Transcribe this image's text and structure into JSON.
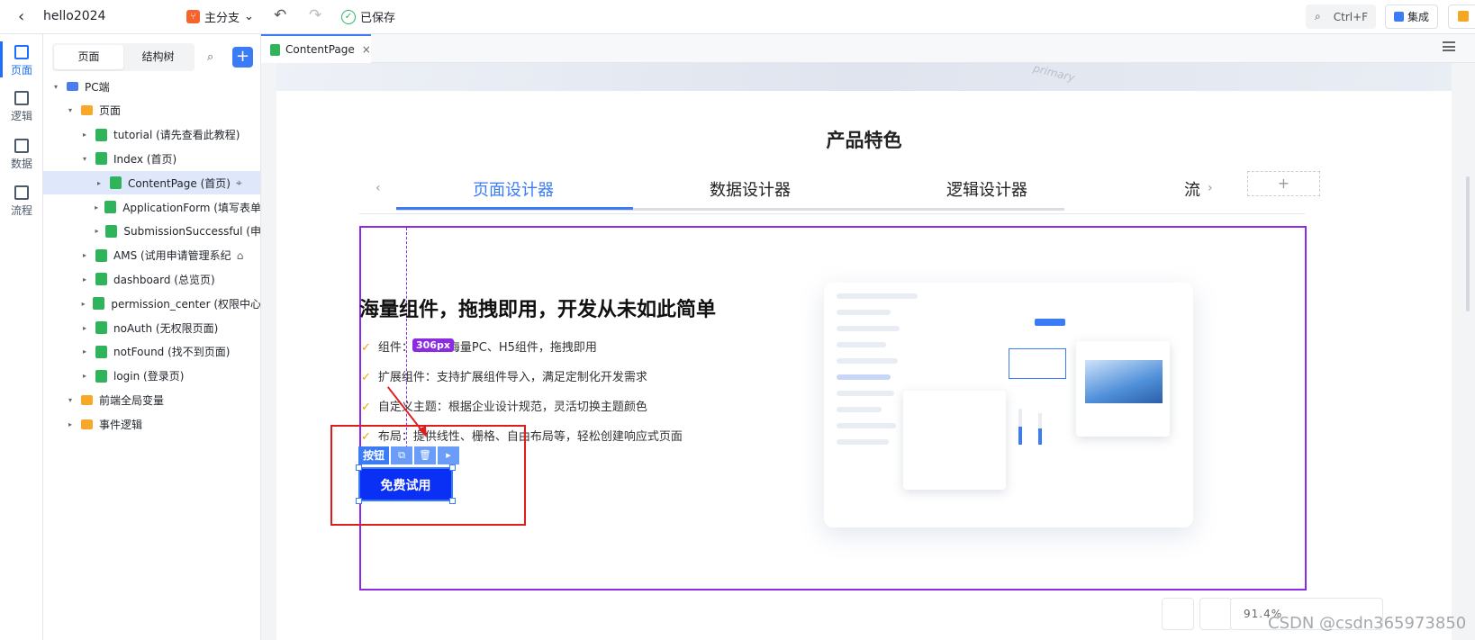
{
  "topbar": {
    "project": "hello2024",
    "branch": "主分支",
    "saved": "已保存",
    "search_shortcut": "Ctrl+F",
    "integrate": "集成"
  },
  "rail": [
    {
      "label": "页面",
      "icon": "page-icon"
    },
    {
      "label": "逻辑",
      "icon": "logic-icon"
    },
    {
      "label": "数据",
      "icon": "data-icon"
    },
    {
      "label": "流程",
      "icon": "flow-icon"
    }
  ],
  "tree": {
    "tabs": [
      "页面",
      "结构树"
    ],
    "nodes": [
      {
        "label": "PC端",
        "type": "pc",
        "depth": 0,
        "caret": "▾"
      },
      {
        "label": "页面",
        "type": "folder",
        "depth": 1,
        "caret": "▾"
      },
      {
        "label": "tutorial (请先查看此教程)",
        "type": "page",
        "depth": 2,
        "caret": "▸"
      },
      {
        "label": "Index (首页)",
        "type": "page",
        "depth": 2,
        "caret": "▾"
      },
      {
        "label": "ContentPage (首页)",
        "type": "page",
        "depth": 3,
        "caret": "▸",
        "selected": true,
        "suffix": "⌖"
      },
      {
        "label": "ApplicationForm (填写表单",
        "type": "page",
        "depth": 3,
        "caret": "▸"
      },
      {
        "label": "SubmissionSuccessful (申",
        "type": "page",
        "depth": 3,
        "caret": "▸"
      },
      {
        "label": "AMS (试用申请管理系纪",
        "type": "page",
        "depth": 2,
        "caret": "▸",
        "suffix": "⌂"
      },
      {
        "label": "dashboard (总览页)",
        "type": "page",
        "depth": 2,
        "caret": "▸"
      },
      {
        "label": "permission_center (权限中心",
        "type": "page",
        "depth": 2,
        "caret": "▸"
      },
      {
        "label": "noAuth (无权限页面)",
        "type": "page",
        "depth": 2,
        "caret": "▸"
      },
      {
        "label": "notFound (找不到页面)",
        "type": "page",
        "depth": 2,
        "caret": "▸"
      },
      {
        "label": "login (登录页)",
        "type": "page",
        "depth": 2,
        "caret": "▸"
      },
      {
        "label": "前端全局变量",
        "type": "folder",
        "depth": 1,
        "caret": "▾"
      },
      {
        "label": "事件逻辑",
        "type": "folder",
        "depth": 1,
        "caret": "▸"
      }
    ]
  },
  "editor_tab": {
    "label": "ContentPage",
    "close": "×"
  },
  "canvas": {
    "banner_text": "primary",
    "section_title": "产品特色",
    "feature_tabs": [
      "页面设计器",
      "数据设计器",
      "逻辑设计器",
      "流"
    ],
    "add_tab": "+",
    "headline": "海量组件，拖拽即用，开发从未如此简单",
    "features": [
      "组件：丰富的海量PC、H5组件，拖拽即用",
      "扩展组件：支持扩展组件导入，满足定制化开发需求",
      "自定义主题：根据企业设计规范，灵活切换主题颜色",
      "布局：提供线性、栅格、自由布局等，轻松创建响应式页面"
    ],
    "width_badge": "306px",
    "component_tag": "按钮",
    "button_label": "免费试用"
  },
  "status": {
    "zoom": "91.4%"
  },
  "watermark": "CSDN @csdn365973850",
  "colors": {
    "accent": "#3b7cf6",
    "selection": "#8b2be2",
    "annotation": "#e11c1c",
    "button": "#0a2ff5"
  }
}
